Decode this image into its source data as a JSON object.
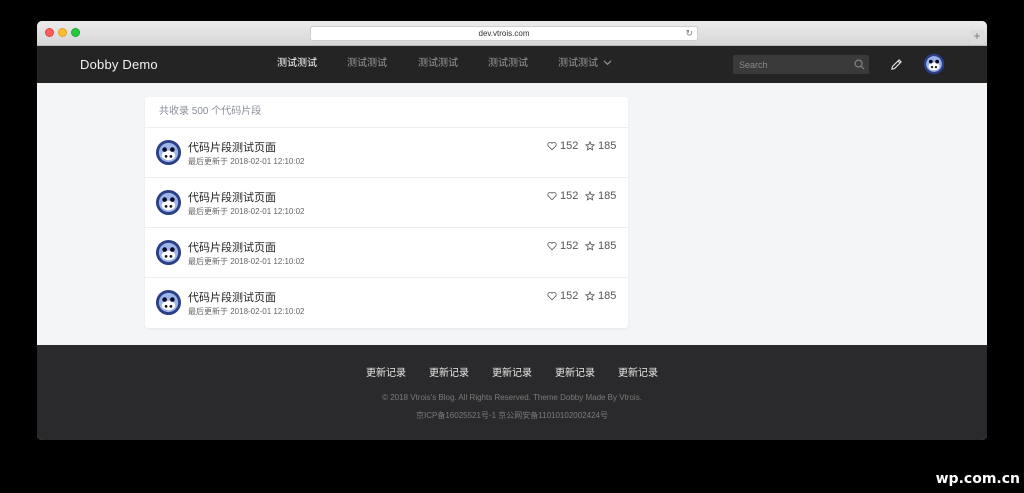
{
  "browser": {
    "url": "dev.vtrois.com",
    "new_tab_label": "+"
  },
  "navbar": {
    "brand": "Dobby Demo",
    "items": [
      {
        "label": "测试测试",
        "active": true
      },
      {
        "label": "测试测试",
        "active": false
      },
      {
        "label": "测试测试",
        "active": false
      },
      {
        "label": "测试测试",
        "active": false
      },
      {
        "label": "测试测试",
        "active": false,
        "has_dropdown": true
      }
    ],
    "search_placeholder": "Search",
    "icons": [
      "search-icon",
      "pencil-icon",
      "avatar"
    ]
  },
  "card": {
    "header": "共收录 500 个代码片段",
    "rows": [
      {
        "title": "代码片段测试页面",
        "meta": "最后更新于 2018-02-01 12:10:02",
        "likes": "152",
        "stars": "185"
      },
      {
        "title": "代码片段测试页面",
        "meta": "最后更新于 2018-02-01 12:10:02",
        "likes": "152",
        "stars": "185"
      },
      {
        "title": "代码片段测试页面",
        "meta": "最后更新于 2018-02-01 12:10:02",
        "likes": "152",
        "stars": "185"
      },
      {
        "title": "代码片段测试页面",
        "meta": "最后更新于 2018-02-01 12:10:02",
        "likes": "152",
        "stars": "185"
      }
    ]
  },
  "footer": {
    "links": [
      "更新记录",
      "更新记录",
      "更新记录",
      "更新记录",
      "更新记录"
    ],
    "copyright": "© 2018 Vtrois's Blog. All Rights Reserved. Theme Dobby Made By Vtrois.",
    "icp": "京ICP备16025521号-1 京公网安备11010102002424号"
  },
  "watermark": "wp.com.cn",
  "colors": {
    "navbar_bg": "#242424",
    "footer_bg": "#2a2a2c",
    "page_bg": "#f4f5f7"
  }
}
